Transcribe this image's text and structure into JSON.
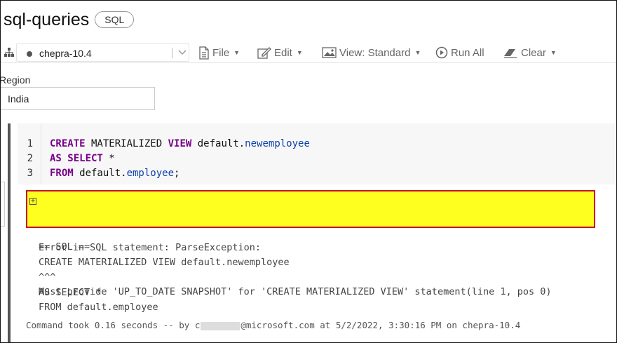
{
  "notebook": {
    "title": "sql-queries",
    "language": "SQL"
  },
  "toolbar": {
    "cluster": "chepra-10.4",
    "file_label": "File",
    "edit_label": "Edit",
    "view_label": "View: Standard",
    "run_all_label": "Run All",
    "clear_label": "Clear"
  },
  "widget": {
    "label": "Region",
    "value": "India"
  },
  "cell": {
    "line_numbers": [
      "1",
      "2",
      "3"
    ],
    "code": [
      [
        {
          "t": "CREATE",
          "c": "kw"
        },
        {
          "t": " MATERIALIZED ",
          "c": ""
        },
        {
          "t": "VIEW",
          "c": "kw"
        },
        {
          "t": " default.",
          "c": ""
        },
        {
          "t": "newemployee",
          "c": "ident"
        }
      ],
      [
        {
          "t": "AS SELECT",
          "c": "kw"
        },
        {
          "t": " *",
          "c": ""
        }
      ],
      [
        {
          "t": "FROM",
          "c": "kw"
        },
        {
          "t": " default.",
          "c": ""
        },
        {
          "t": "employee",
          "c": "ident"
        },
        {
          "t": ";",
          "c": ""
        }
      ]
    ]
  },
  "error": {
    "line1": "Error in SQL statement: ParseException:",
    "line2": "Must provide 'UP_TO_DATE SNAPSHOT' for 'CREATE MATERIALIZED VIEW' statement(line 1, pos 0)"
  },
  "trace_lines": [
    "== SQL ==",
    "CREATE MATERIALIZED VIEW default.newemployee",
    "^^^",
    "AS SELECT *",
    "FROM default.employee"
  ],
  "footer": {
    "prefix": "Command took 0.16 seconds -- by c",
    "suffix": "@microsoft.com at 5/2/2022, 3:30:16 PM on chepra-10.4"
  }
}
